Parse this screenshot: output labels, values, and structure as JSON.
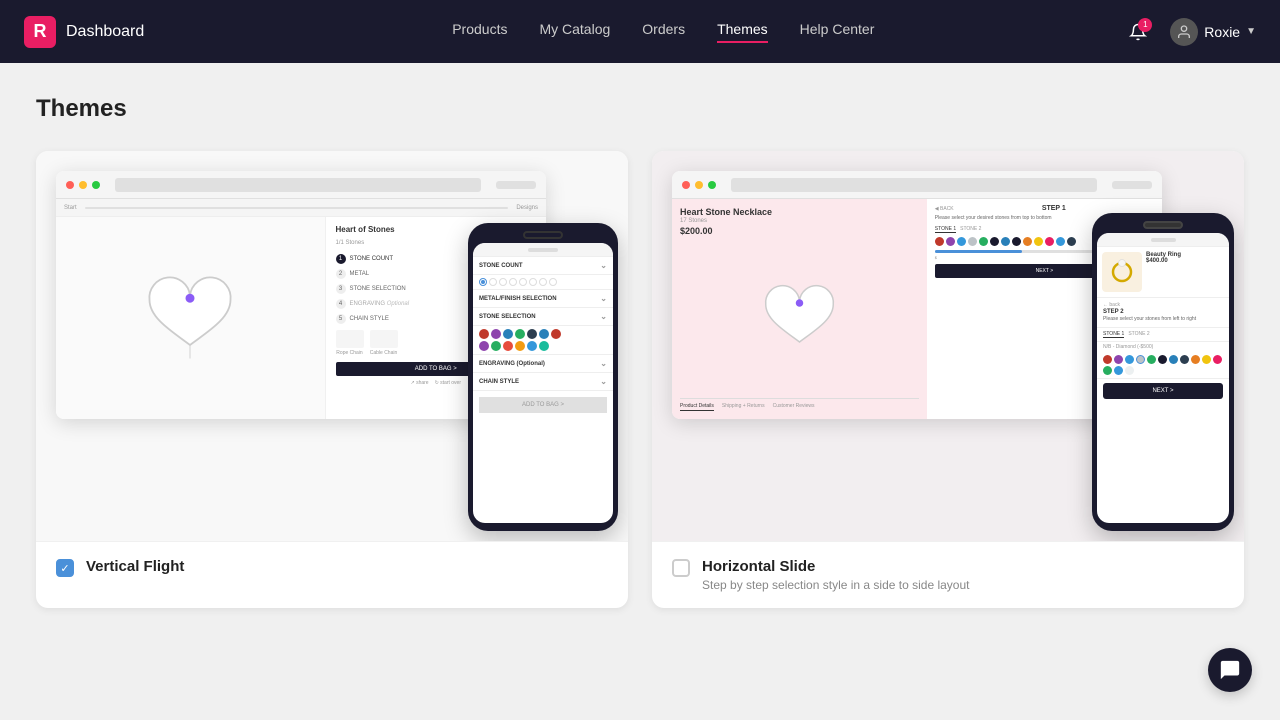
{
  "nav": {
    "logo_letter": "R",
    "logo_text": "Dashboard",
    "links": [
      {
        "id": "products",
        "label": "Products",
        "active": false
      },
      {
        "id": "my-catalog",
        "label": "My Catalog",
        "active": false
      },
      {
        "id": "orders",
        "label": "Orders",
        "active": false
      },
      {
        "id": "themes",
        "label": "Themes",
        "active": true
      },
      {
        "id": "help-center",
        "label": "Help Center",
        "active": false
      }
    ],
    "notification_count": "1",
    "user_name": "Roxie"
  },
  "page": {
    "title": "Themes"
  },
  "themes": [
    {
      "id": "vertical-flight",
      "name": "Vertical Flight",
      "description": "",
      "checked": true,
      "preview": {
        "product_title": "Heart of Stones",
        "steps": [
          "STONE COUNT",
          "METAL",
          "STONE SELECTION",
          "ENGRAVING",
          "CHAIN STYLE"
        ],
        "phone_sections": [
          "STONE COUNT",
          "METAL/FINISH SELECTION",
          "STONE SELECTION",
          "ENGRAVING (Optional)",
          "CHAIN STYLE"
        ],
        "add_to_bag": "ADD TO BAG >"
      }
    },
    {
      "id": "horizontal-slide",
      "name": "Horizontal Slide",
      "description": "Step by step selection style in a side to side layout",
      "checked": false,
      "preview": {
        "product_title": "Heart Stone Necklace",
        "product_subtitle": "17 Stones",
        "product_price": "$200.00",
        "step": "STEP 1",
        "step_instruction": "Please select your desired stones from top to bottom",
        "tabs": [
          "Product Details",
          "Shipping + Returns",
          "Customer Reviews"
        ],
        "phone_product_title": "Beauty Ring",
        "phone_product_price": "$400.00",
        "phone_step": "STEP 2",
        "phone_step_label": "Please select your stones from left to right",
        "next_label": "NEXT >"
      }
    }
  ],
  "chat": {
    "icon": "💬"
  }
}
